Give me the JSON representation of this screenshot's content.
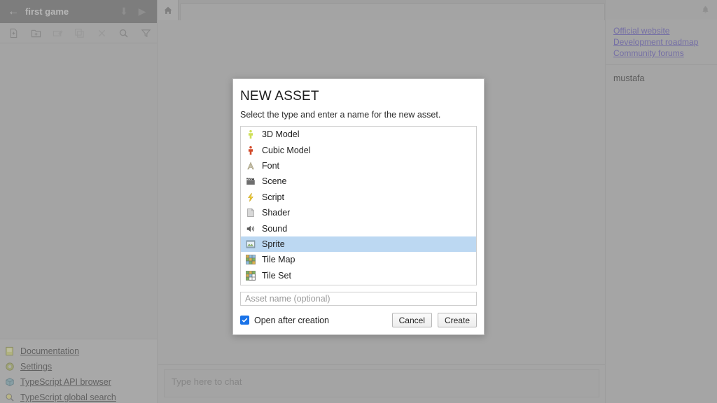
{
  "window": {
    "background_color": "#c4c4c4"
  },
  "project": {
    "back_icon": "back-arrow-icon",
    "title": "first game",
    "download_icon": "download-icon",
    "play_icon": "play-icon"
  },
  "asset_toolbar": {
    "buttons": [
      {
        "name": "new-asset-button",
        "icon": "new-file-icon"
      },
      {
        "name": "new-folder-button",
        "icon": "new-folder-icon"
      },
      {
        "name": "rename-button",
        "icon": "rename-icon"
      },
      {
        "name": "duplicate-button",
        "icon": "duplicate-icon"
      },
      {
        "name": "delete-button",
        "icon": "close-x-icon"
      },
      {
        "name": "search-button",
        "icon": "search-icon"
      },
      {
        "name": "filter-button",
        "icon": "filter-icon"
      }
    ]
  },
  "sidebar_links": [
    {
      "icon": "book-icon",
      "label": "Documentation"
    },
    {
      "icon": "gear-icon",
      "label": "Settings"
    },
    {
      "icon": "cube-icon",
      "label": "TypeScript API browser"
    },
    {
      "icon": "magnifier-icon",
      "label": "TypeScript global search"
    }
  ],
  "tabs": [
    {
      "icon": "home-icon",
      "name": "tab-home",
      "label": ""
    }
  ],
  "chat": {
    "placeholder": "Type here to chat",
    "value": ""
  },
  "right_panel": {
    "notification_icon": "bell-icon",
    "links": [
      "Official website",
      "Development roadmap",
      "Community forums"
    ],
    "link_color": "#6a5fc4",
    "user": "mustafa"
  },
  "modal": {
    "title": "NEW ASSET",
    "subtitle": "Select the type and enter a name for the new asset.",
    "selected_type": "Sprite",
    "selection_color": "#bcd8f2",
    "types": [
      {
        "label": "3D Model",
        "icon": "model-3d-icon"
      },
      {
        "label": "Cubic Model",
        "icon": "cubic-model-icon"
      },
      {
        "label": "Font",
        "icon": "font-icon"
      },
      {
        "label": "Scene",
        "icon": "scene-clapperboard-icon"
      },
      {
        "label": "Script",
        "icon": "script-lightning-icon"
      },
      {
        "label": "Shader",
        "icon": "shader-page-icon"
      },
      {
        "label": "Sound",
        "icon": "sound-speaker-icon"
      },
      {
        "label": "Sprite",
        "icon": "sprite-image-icon"
      },
      {
        "label": "Tile Map",
        "icon": "tile-map-icon"
      },
      {
        "label": "Tile Set",
        "icon": "tile-set-icon"
      }
    ],
    "name_input": {
      "placeholder": "Asset name (optional)",
      "value": ""
    },
    "checkbox": {
      "label": "Open after creation",
      "checked": true,
      "color": "#1a73e8"
    },
    "cancel_label": "Cancel",
    "create_label": "Create"
  }
}
